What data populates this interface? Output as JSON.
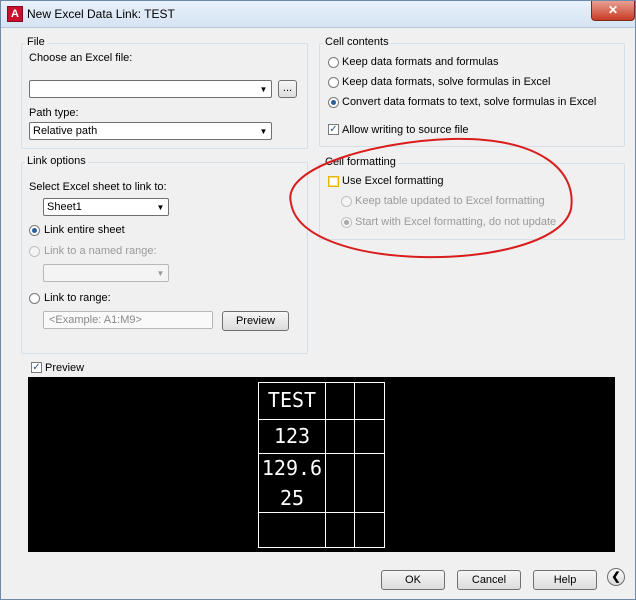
{
  "window": {
    "title": "New Excel Data Link: TEST",
    "close_glyph": "✕"
  },
  "file": {
    "group_title": "File",
    "choose_label": "Choose an Excel file:",
    "file_value": "",
    "browse_label": "...",
    "path_type_label": "Path type:",
    "path_type_value": "Relative path"
  },
  "link_options": {
    "group_title": "Link options",
    "select_sheet_label": "Select Excel sheet to link to:",
    "sheet_value": "Sheet1",
    "link_entire_sheet": "Link entire sheet",
    "link_named_range": "Link to a named range:",
    "named_range_value": "",
    "link_to_range": "Link to range:",
    "range_placeholder": "<Example: A1:M9>",
    "preview_button": "Preview"
  },
  "cell_contents": {
    "group_title": "Cell contents",
    "opt1": "Keep data formats and formulas",
    "opt2": "Keep data formats, solve formulas in Excel",
    "opt3": "Convert data formats to text, solve formulas in Excel",
    "allow_writing": "Allow writing to source file"
  },
  "cell_formatting": {
    "group_title": "Cell formatting",
    "use_excel_formatting": "Use Excel formatting",
    "keep_updated": "Keep table updated to Excel formatting",
    "start_with": "Start with Excel formatting, do not update"
  },
  "preview": {
    "label": "Preview",
    "table": [
      "TEST",
      "123",
      "129.6",
      "25"
    ]
  },
  "footer": {
    "ok": "OK",
    "cancel": "Cancel",
    "help": "Help",
    "collapse_glyph": "❮"
  },
  "colors": {
    "annotation_ellipse": "#d91c1c",
    "preview_bg": "#000000",
    "radio_selected": "#2d5d9a"
  },
  "icons": {
    "app": "autocad-icon",
    "close": "close-icon",
    "dropdown": "chevron-down-icon",
    "collapse": "chevron-left-icon"
  }
}
